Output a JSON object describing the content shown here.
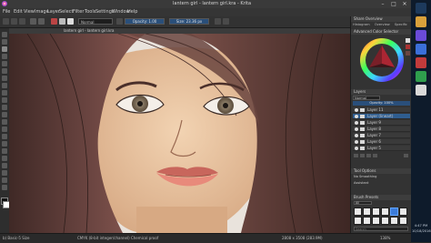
{
  "window": {
    "title": "lantern girl - lantern girl.kra - Krita",
    "min": "–",
    "max": "□",
    "close": "✕"
  },
  "menu": [
    "File",
    "Edit",
    "View",
    "Image",
    "Layer",
    "Select",
    "Filter",
    "Tools",
    "Settings",
    "Window",
    "Help"
  ],
  "tool_options": {
    "blend_mode": "Normal",
    "opacity_label": "Opacity: 1.00",
    "size_label": "Size: 23.36 px"
  },
  "document_tab": "lantern girl - lantern girl.kra",
  "dockers": {
    "color": {
      "title": "Share Overview",
      "tabs": [
        "Histogram",
        "Overview",
        "Specific"
      ],
      "sub_title": "Advanced Color Selector"
    },
    "layers": {
      "title": "Layers",
      "blend": "Normal",
      "opacity": "Opacity: 100%",
      "items": [
        {
          "name": "Layer 11",
          "selected": false
        },
        {
          "name": "Layer (lineart)",
          "selected": true
        },
        {
          "name": "Layer 9",
          "selected": false
        },
        {
          "name": "Layer 8",
          "selected": false
        },
        {
          "name": "Layer 7",
          "selected": false
        },
        {
          "name": "Layer 6",
          "selected": false
        },
        {
          "name": "Layer 5",
          "selected": false
        }
      ]
    },
    "tool_options": {
      "title": "Tool Options",
      "smoothing_label": "No Smoothing",
      "assistant_label": "Assistant"
    },
    "presets": {
      "title": "Brush Presets",
      "tag_label": "All",
      "search_placeholder": "Search"
    }
  },
  "status": {
    "preset": "b) Basic-5 Size",
    "color_profile": "CMYK (8-bit integer/channel) Chemical proof",
    "dimensions": "2808 x 3508 (283.9M)",
    "zoom": "138%"
  },
  "taskbar": {
    "time": "4:47 PM",
    "date": "10/18/2016"
  },
  "colors": {
    "skin": "#e8c4a0",
    "hair": "#5d3b36",
    "lips": "#e07a6c",
    "selection_blue": "#2f5d8f",
    "taskbar": "#0e1b2b"
  }
}
